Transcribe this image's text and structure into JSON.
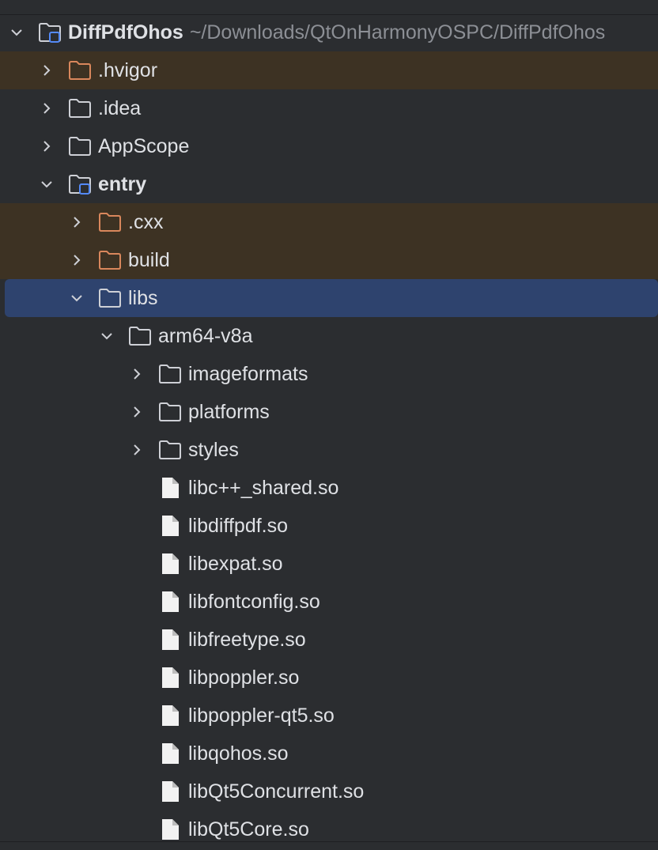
{
  "tree": {
    "root": {
      "name": "DiffPdfOhos",
      "path": "~/Downloads/QtOnHarmonyOSPC/DiffPdfOhos"
    },
    "hvigor": {
      "name": ".hvigor"
    },
    "idea": {
      "name": ".idea"
    },
    "appscope": {
      "name": "AppScope"
    },
    "entry": {
      "name": "entry"
    },
    "cxx": {
      "name": ".cxx"
    },
    "build": {
      "name": "build"
    },
    "libs": {
      "name": "libs"
    },
    "arm64": {
      "name": "arm64-v8a"
    },
    "imageformats": {
      "name": "imageformats"
    },
    "platforms": {
      "name": "platforms"
    },
    "styles": {
      "name": "styles"
    },
    "files": [
      "libc++_shared.so",
      "libdiffpdf.so",
      "libexpat.so",
      "libfontconfig.so",
      "libfreetype.so",
      "libpoppler.so",
      "libpoppler-qt5.so",
      "libqohos.so",
      "libQt5Concurrent.so",
      "libQt5Core.so"
    ]
  },
  "colors": {
    "background": "#2b2d30",
    "selected_row": "#2e436e",
    "excluded_row": "#3d3223",
    "excluded_folder": "#d9875c",
    "module_badge": "#548af7"
  },
  "icons": {
    "expanded": "chevron-down-icon",
    "collapsed": "chevron-right-icon",
    "folder": "folder-icon",
    "module_folder": "module-folder-icon",
    "file": "file-icon"
  }
}
